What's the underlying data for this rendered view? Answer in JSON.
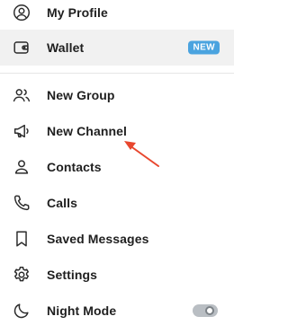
{
  "menu": {
    "items": [
      {
        "label": "My Profile",
        "icon": "user-circle-icon"
      },
      {
        "label": "Wallet",
        "icon": "wallet-icon",
        "badge": "NEW",
        "active": true
      },
      {
        "label": "New Group",
        "icon": "group-icon"
      },
      {
        "label": "New Channel",
        "icon": "megaphone-icon"
      },
      {
        "label": "Contacts",
        "icon": "person-icon"
      },
      {
        "label": "Calls",
        "icon": "phone-icon"
      },
      {
        "label": "Saved Messages",
        "icon": "bookmark-icon"
      },
      {
        "label": "Settings",
        "icon": "gear-icon"
      },
      {
        "label": "Night Mode",
        "icon": "moon-icon",
        "toggle": false
      }
    ]
  },
  "colors": {
    "badge": "#4aa3df",
    "active_row": "#f1f1f1",
    "annotation_arrow": "#e8472e"
  }
}
